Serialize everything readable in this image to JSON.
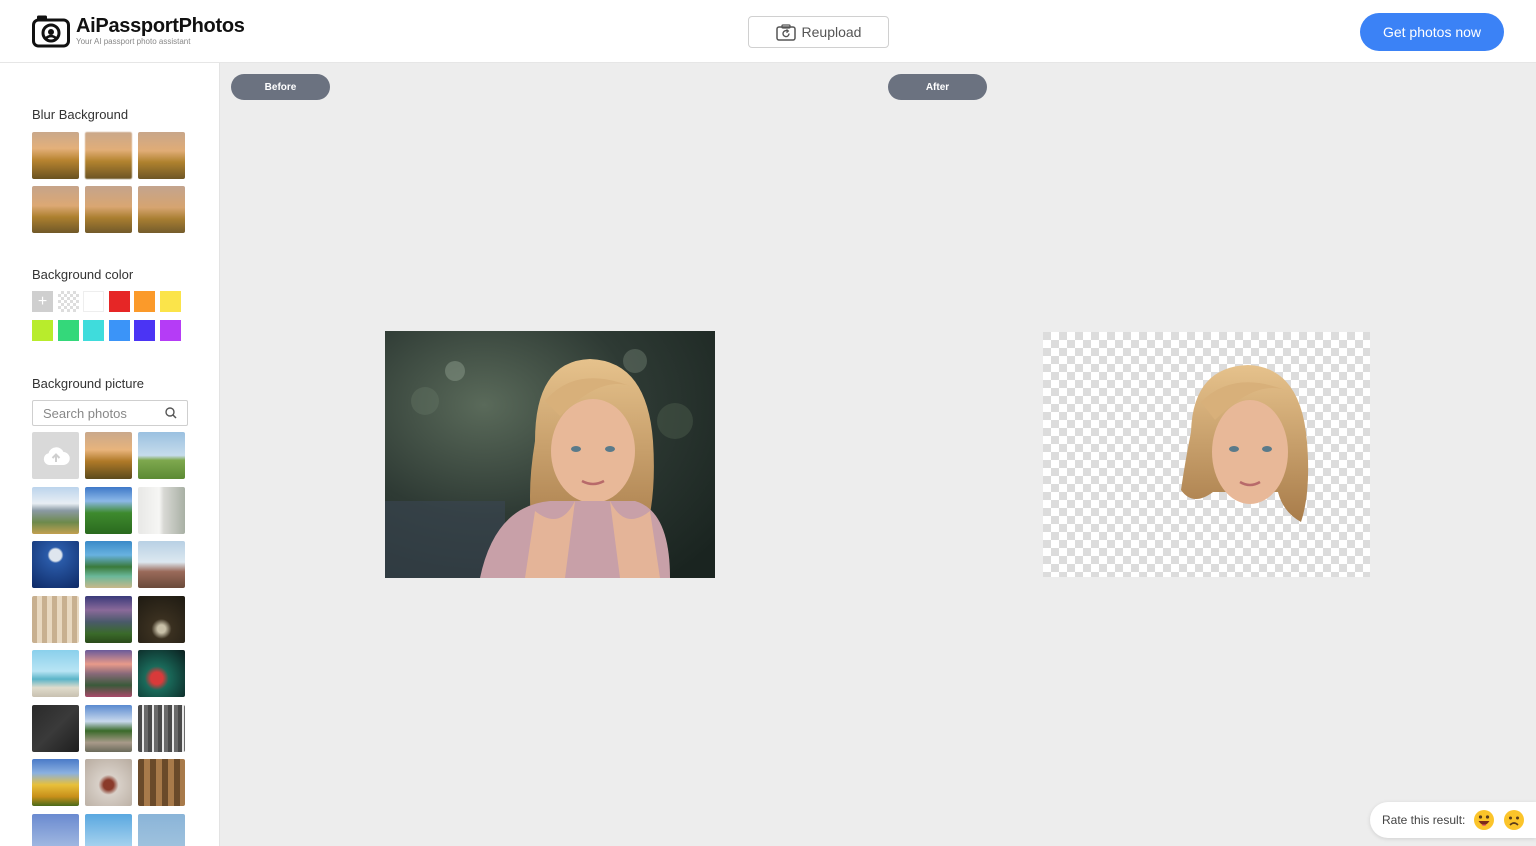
{
  "header": {
    "brand_name": "AiPassportPhotos",
    "brand_tagline": "Your AI passport photo assistant",
    "reupload_label": "Reupload",
    "get_photos_label": "Get photos now"
  },
  "sidebar": {
    "blur_title": "Blur Background",
    "blur_levels": [
      1,
      2,
      3,
      4,
      5,
      6
    ],
    "color_title": "Background color",
    "colors": [
      "#ffffff",
      "#e62626",
      "#fb9a2a",
      "#fbe44a",
      "#b8ec2c",
      "#34d87a",
      "#3fdcdc",
      "#3b94f8",
      "#4b34f4",
      "#b53cf6"
    ],
    "picture_title": "Background picture",
    "search_placeholder": "Search photos",
    "pictures": [
      "desert",
      "field-tree",
      "mountain",
      "green-hills",
      "interior",
      "moon",
      "tree-car",
      "field",
      "curtains",
      "sunset-mountains",
      "forest-bench",
      "beach",
      "flower-field",
      "neon-plant",
      "chalkboard",
      "road",
      "birch-forest",
      "tulips",
      "hallway",
      "columns",
      "sky",
      "clouds",
      "lake"
    ]
  },
  "main": {
    "before_label": "Before",
    "after_label": "After"
  },
  "rating": {
    "label": "Rate this result:"
  }
}
